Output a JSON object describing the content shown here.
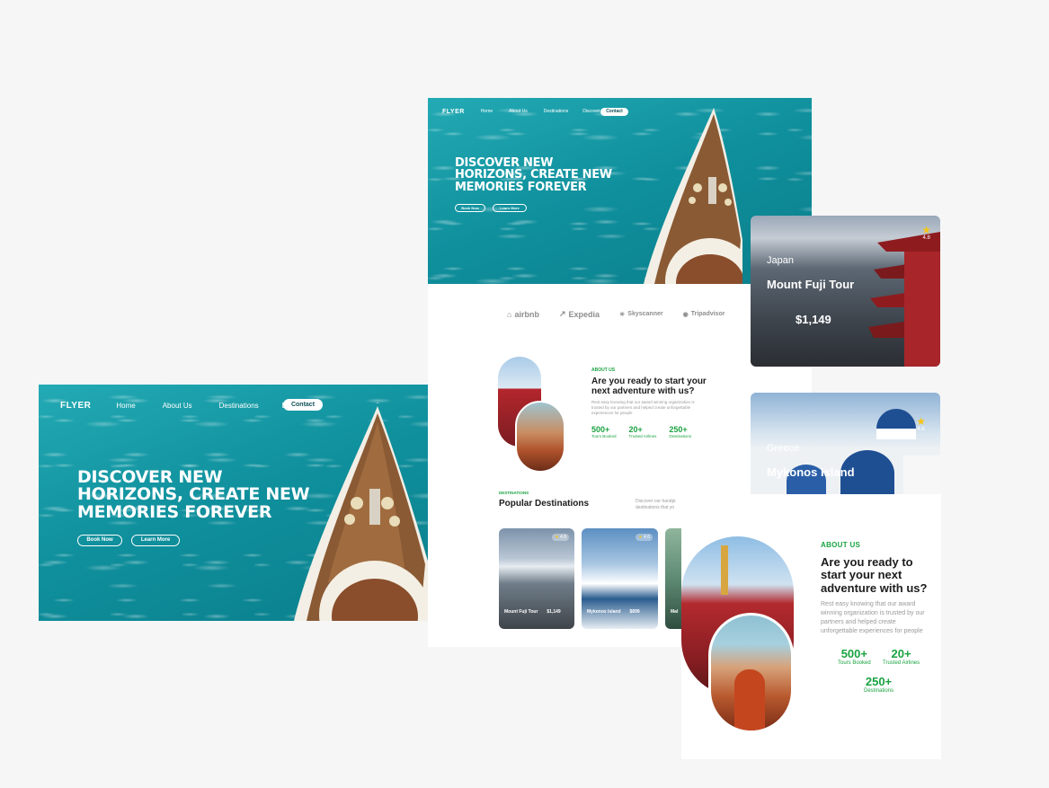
{
  "brand": "FLYER",
  "nav": {
    "links": [
      "Home",
      "About Us",
      "Destinations",
      "Discover"
    ],
    "contact": "Contact"
  },
  "hero": {
    "title_lines": [
      "DISCOVER NEW",
      "HORIZONS, CREATE NEW",
      "MEMORIES FOREVER"
    ],
    "book_now": "Book Now",
    "learn_more": "Learn More"
  },
  "partners": [
    "airbnb",
    "Expedia",
    "Skyscanner",
    "Tripadvisor"
  ],
  "about": {
    "eyebrow": "ABOUT US",
    "title_mid": [
      "Are you ready to start your",
      "next adventure with us?"
    ],
    "title_right": [
      "Are you ready to",
      "start your next",
      "adventure with us?"
    ],
    "body_mid": [
      "Rest easy knowing that our award winning organization is",
      "trusted by our partners and helped create unforgettable",
      "experiences for people"
    ],
    "body_right": [
      "Rest easy knowing that our award",
      "winning organization is trusted by our",
      "partners and helped create",
      "unforgettable experiences for people"
    ],
    "stats": [
      {
        "value": "500+",
        "label": "Tours Booked"
      },
      {
        "value": "20+",
        "label": "Trusted Airlines"
      },
      {
        "value": "250+",
        "label": "Destinations"
      }
    ]
  },
  "destinations": {
    "eyebrow": "DESTINATIONS",
    "title": "Popular Destinations",
    "desc": [
      "Discover our handpi",
      "destinations that yo"
    ],
    "cards": [
      {
        "name": "Mount Fuji Tour",
        "price": "$1,149",
        "rating": "4.8"
      },
      {
        "name": "Mykonos Island",
        "price": "$899",
        "rating": "4.6"
      },
      {
        "name": "Mal",
        "price": "",
        "rating": ""
      }
    ]
  },
  "featured": [
    {
      "country": "Japan",
      "name": "Mount Fuji Tour",
      "price": "$1,149",
      "rating": "4.8"
    },
    {
      "country": "Greece",
      "name": "Mykonos Island",
      "rating": "4.6"
    }
  ],
  "colors": {
    "accent": "#1aa341",
    "ocean": "#1a9aa6",
    "background": "#f6f6f6"
  }
}
